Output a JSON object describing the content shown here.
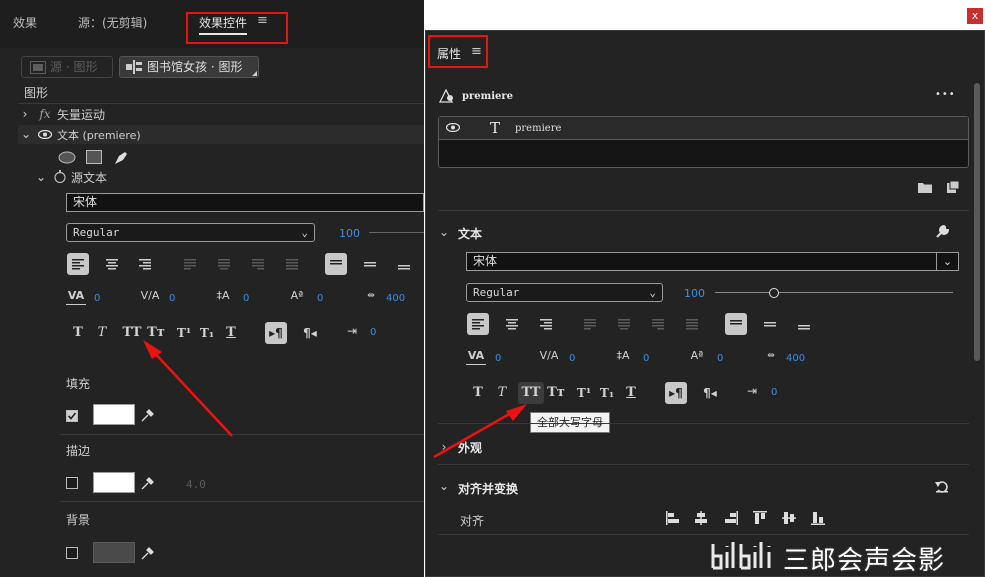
{
  "left": {
    "tabs": [
      "效果",
      "源：(无剪辑)",
      "效果控件"
    ],
    "source_btn": "源 · 图形",
    "seq_btn": "图书馆女孩 · 图形",
    "section": "图形",
    "vector_motion": "矢量运动",
    "text_layer": "文本 (premiere)",
    "source_text": "源文本",
    "font": "宋体",
    "style": "Regular",
    "size": "100",
    "kern": "0",
    "track": "0",
    "lead": "0",
    "baseline": "0",
    "tsume": "400",
    "indent": "0",
    "fill_label": "填充",
    "stroke_label": "描边",
    "stroke_width": "4.0",
    "bg_label": "背景"
  },
  "right": {
    "panel_title": "属性",
    "layer_group": "premiere",
    "layer_item": "premiere",
    "more": "•••",
    "text_section": "文本",
    "font": "宋体",
    "style": "Regular",
    "size": "100",
    "kern": "0",
    "track": "0",
    "lead": "0",
    "baseline": "0",
    "tsume": "400",
    "indent": "0",
    "tooltip": "全部大写字母",
    "appearance": "外观",
    "align_transform": "对齐并变换",
    "align_label": "对齐"
  },
  "text_style_glyphs": [
    "T",
    "T",
    "TT",
    "Tт",
    "T¹",
    "T₁",
    "T"
  ],
  "watermark": "三郎会声会影",
  "close_glyph": "x",
  "colors": {
    "panel": "#232323",
    "accent": "#3f8fe0",
    "highlight": "#e11111"
  }
}
